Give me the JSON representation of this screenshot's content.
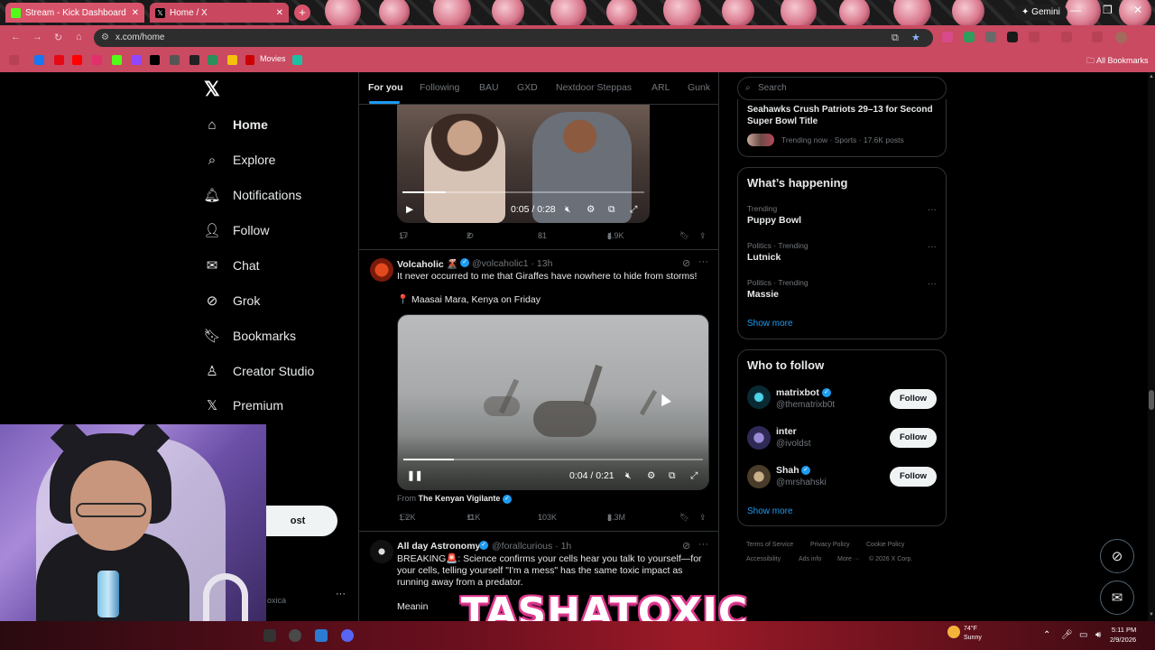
{
  "browser": {
    "tabs": [
      {
        "title": "Stream - Kick Dashboard",
        "favicon_color": "#53fc18"
      },
      {
        "title": "Home / X",
        "favicon_color": "#000000"
      }
    ],
    "gemini_label": "Gemini",
    "url": "x.com/home",
    "bookmarks": {
      "movies_label": "Movies",
      "all_label": "All Bookmarks"
    }
  },
  "x": {
    "nav": [
      {
        "label": "Home",
        "icon": "home-icon"
      },
      {
        "label": "Explore",
        "icon": "search-icon"
      },
      {
        "label": "Notifications",
        "icon": "bell-icon"
      },
      {
        "label": "Follow",
        "icon": "follow-icon"
      },
      {
        "label": "Chat",
        "icon": "mail-icon"
      },
      {
        "label": "Grok",
        "icon": "grok-icon"
      },
      {
        "label": "Bookmarks",
        "icon": "bookmark-icon"
      },
      {
        "label": "Creator Studio",
        "icon": "creator-icon"
      },
      {
        "label": "Premium",
        "icon": "x-icon"
      }
    ],
    "post_button": "ost",
    "profile_partial": "oxica",
    "feed_tabs": [
      "For you",
      "Following",
      "BAU",
      "GXD",
      "Nextdoor Steppas",
      "ARL",
      "Gunk"
    ],
    "posts": [
      {
        "video_time": "0:05 / 0:28",
        "video_progress": 0.18,
        "stats": {
          "replies": "17",
          "reposts": "2",
          "likes": "81",
          "views": "4.9K"
        }
      },
      {
        "name": "Volcaholic 🌋",
        "handle": "@volcaholic1 · 13h",
        "text": "It never occurred to me that Giraffes have nowhere to hide from storms!",
        "location": "📍 Maasai Mara, Kenya on Friday",
        "video_time": "0:04 / 0:21",
        "video_progress": 0.17,
        "from_label": "From",
        "from_name": "The Kenyan Vigilante",
        "stats": {
          "replies": "1.2K",
          "reposts": "11K",
          "likes": "103K",
          "views": "3.3M"
        }
      },
      {
        "name": "All day Astronomy",
        "handle": "@forallcurious · 1h",
        "text_lines": [
          "BREAKING🚨: Science confirms your cells hear you talk to yourself—for",
          "your cells, telling yourself \"I'm a mess\" has the same toxic impact as",
          "running away from a predator."
        ],
        "text_partial": "Meanin"
      }
    ],
    "search_placeholder": "Search",
    "news": {
      "title_lines": [
        "Seahawks Crush Patriots 29–13 for Second",
        "Super Bowl Title"
      ],
      "meta": "Trending now · Sports · 17.6K posts"
    },
    "whats_happening": {
      "title": "What’s happening",
      "items": [
        {
          "context": "Trending",
          "name": "Puppy Bowl"
        },
        {
          "context": "Politics · Trending",
          "name": "Lutnick"
        },
        {
          "context": "Politics · Trending",
          "name": "Massie"
        }
      ],
      "show_more": "Show more"
    },
    "who_to_follow": {
      "title": "Who to follow",
      "users": [
        {
          "name": "matrixbot",
          "handle": "@thematrixb0t",
          "button": "Follow"
        },
        {
          "name": "inter",
          "handle": "@ivoldst",
          "button": "Follow"
        },
        {
          "name": "Shah",
          "handle": "@mrshahski",
          "button": "Follow"
        }
      ],
      "show_more": "Show more"
    },
    "footer": {
      "row1": [
        "Terms of Service",
        "Privacy Policy",
        "Cookie Policy"
      ],
      "row2": [
        "Accessibility",
        "Ads info",
        "More ···",
        "© 2026 X Corp."
      ]
    }
  },
  "overlay": {
    "brand": "TASHATOXIC"
  },
  "taskbar": {
    "weather_temp": "74°F",
    "weather_cond": "Sunny",
    "time": "5:11 PM",
    "date": "2/9/2026"
  }
}
